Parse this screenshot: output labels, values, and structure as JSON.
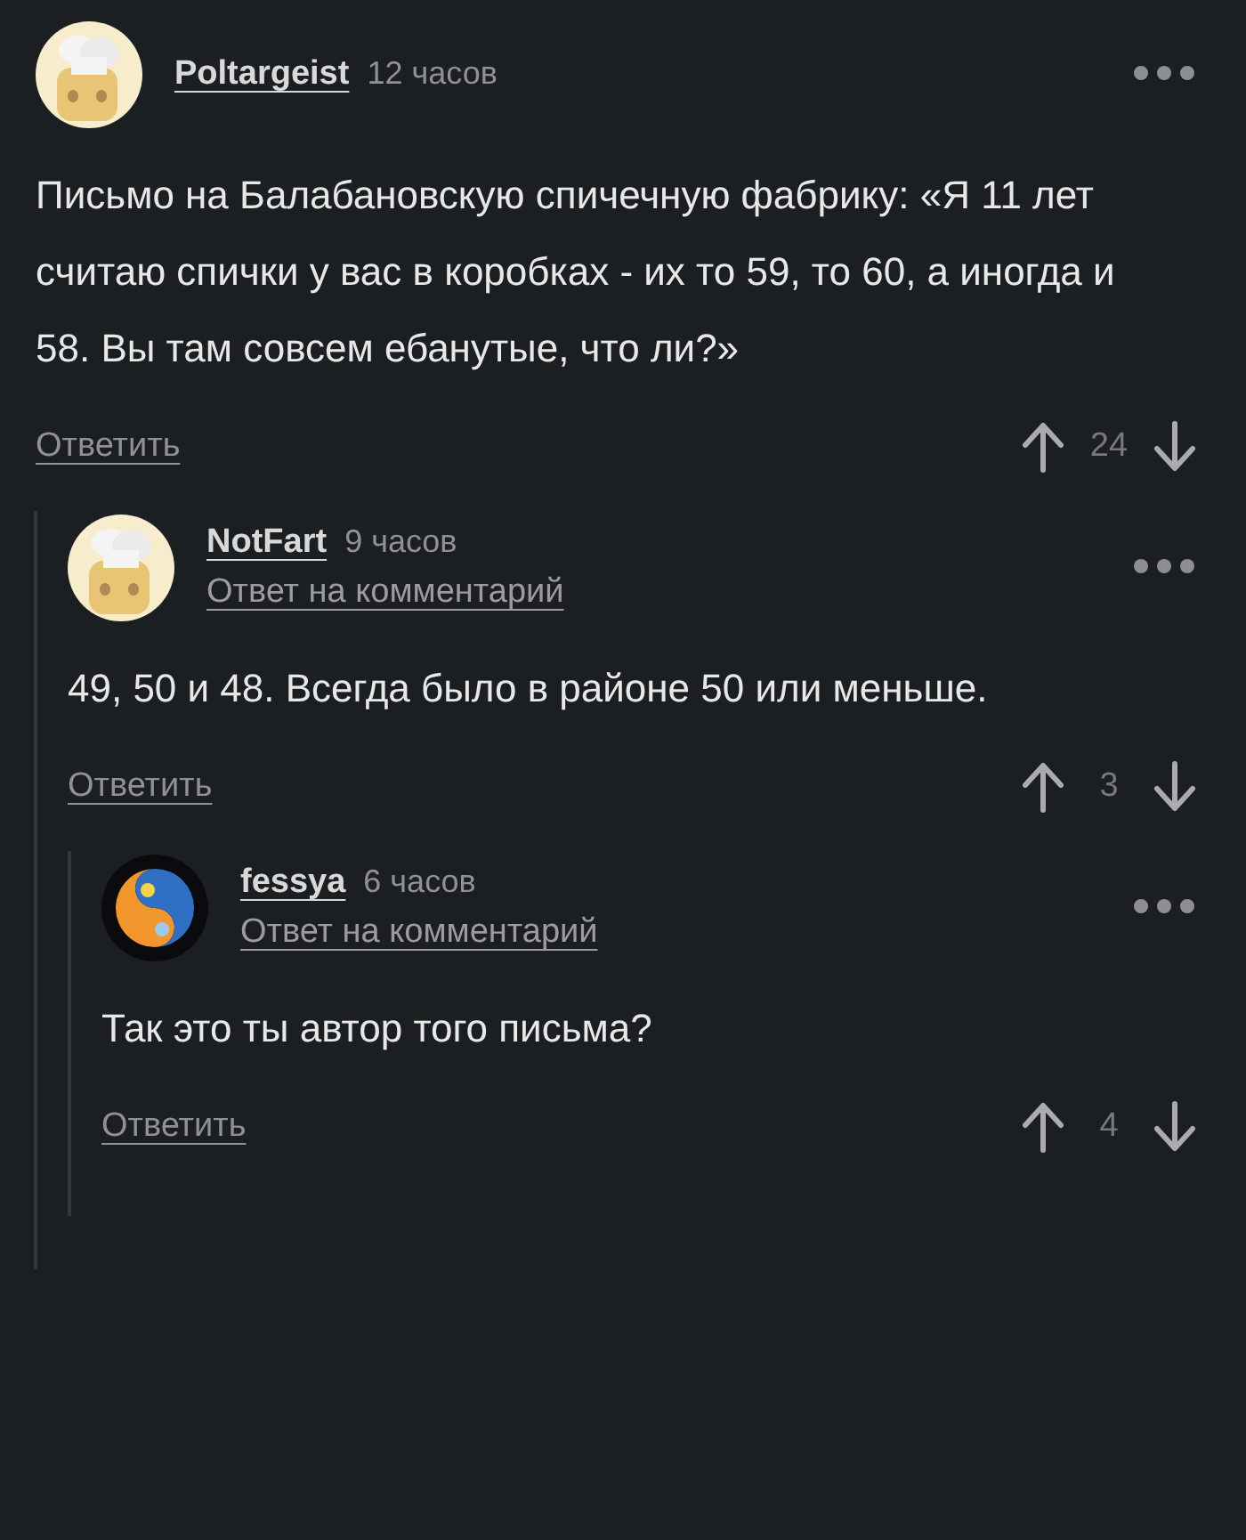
{
  "comments": [
    {
      "author": "Poltargeist",
      "time": "12 часов",
      "avatar": {
        "kind": "chef"
      },
      "text": "Письмо на Балабановскую спичечную фабрику: «Я 11 лет считаю спички у вас в коробках - их то 59, то 60, а иногда и 58. Вы там совсем ебанутые, что ли?»",
      "reply_link": "Ответить",
      "votes": "24",
      "children": [
        {
          "author": "NotFart",
          "time": "9 часов",
          "avatar": {
            "kind": "chef"
          },
          "reply_to": "Ответ на комментарий",
          "text": "49, 50 и 48. Всегда было в районе 50 или меньше.",
          "reply_link": "Ответить",
          "votes": "3",
          "children": [
            {
              "author": "fessya",
              "time": "6 часов",
              "avatar": {
                "kind": "yinyang"
              },
              "reply_to": "Ответ на комментарий",
              "text": "Так это ты автор того письма?",
              "reply_link": "Ответить",
              "votes": "4"
            }
          ]
        }
      ]
    }
  ]
}
